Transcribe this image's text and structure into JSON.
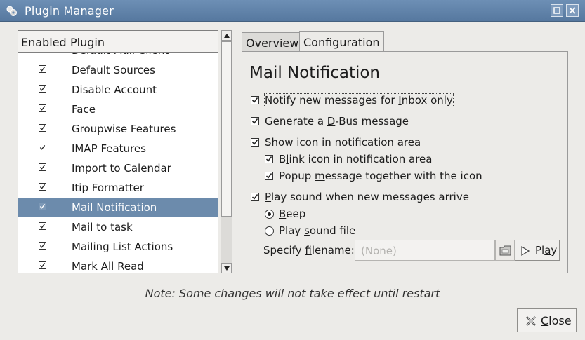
{
  "window": {
    "title": "Plugin Manager"
  },
  "list": {
    "headers": {
      "enabled": "Enabled",
      "plugin": "Plugin"
    },
    "items": [
      {
        "name": "Default Mail Client",
        "enabled": true
      },
      {
        "name": "Default Sources",
        "enabled": true
      },
      {
        "name": "Disable Account",
        "enabled": true
      },
      {
        "name": "Face",
        "enabled": true
      },
      {
        "name": "Groupwise Features",
        "enabled": true
      },
      {
        "name": "IMAP Features",
        "enabled": true
      },
      {
        "name": "Import to Calendar",
        "enabled": true
      },
      {
        "name": "Itip Formatter",
        "enabled": true
      },
      {
        "name": "Mail Notification",
        "enabled": true,
        "selected": true
      },
      {
        "name": "Mail to task",
        "enabled": true
      },
      {
        "name": "Mailing List Actions",
        "enabled": true
      },
      {
        "name": "Mark All Read",
        "enabled": true
      }
    ]
  },
  "tabs": {
    "overview": "Overview",
    "configuration": "Configuration"
  },
  "config": {
    "title": "Mail Notification",
    "options": {
      "inbox_only": {
        "before": "Notify new messages for ",
        "mnemonic": "I",
        "after": "nbox only",
        "checked": true
      },
      "dbus": {
        "before": "Generate a ",
        "mnemonic": "D",
        "after": "-Bus message",
        "checked": true
      },
      "show_icon": {
        "before": "Show icon in ",
        "mnemonic": "n",
        "after": "otification area",
        "checked": true
      },
      "blink": {
        "before": "B",
        "mnemonic": "l",
        "after": "ink icon in notification area",
        "checked": true
      },
      "popup": {
        "before": "Popup ",
        "mnemonic": "m",
        "after": "essage together with the icon",
        "checked": true
      },
      "play_sound": {
        "before": "",
        "mnemonic": "P",
        "after": "lay sound when new messages arrive",
        "checked": true
      },
      "beep": {
        "before": "",
        "mnemonic": "B",
        "after": "eep",
        "selected": true
      },
      "sound_file": {
        "before": "Play ",
        "mnemonic": "s",
        "after": "ound file",
        "selected": false
      }
    },
    "filename": {
      "label_before": "Specify ",
      "label_mnemonic": "f",
      "label_after": "ilename:",
      "value": "(None)"
    },
    "play_button": {
      "before": "Pl",
      "mnemonic": "a",
      "after": "y"
    }
  },
  "note": "Note: Some changes will not take effect until restart",
  "close_button": {
    "mnemonic": "C",
    "after": "lose"
  }
}
